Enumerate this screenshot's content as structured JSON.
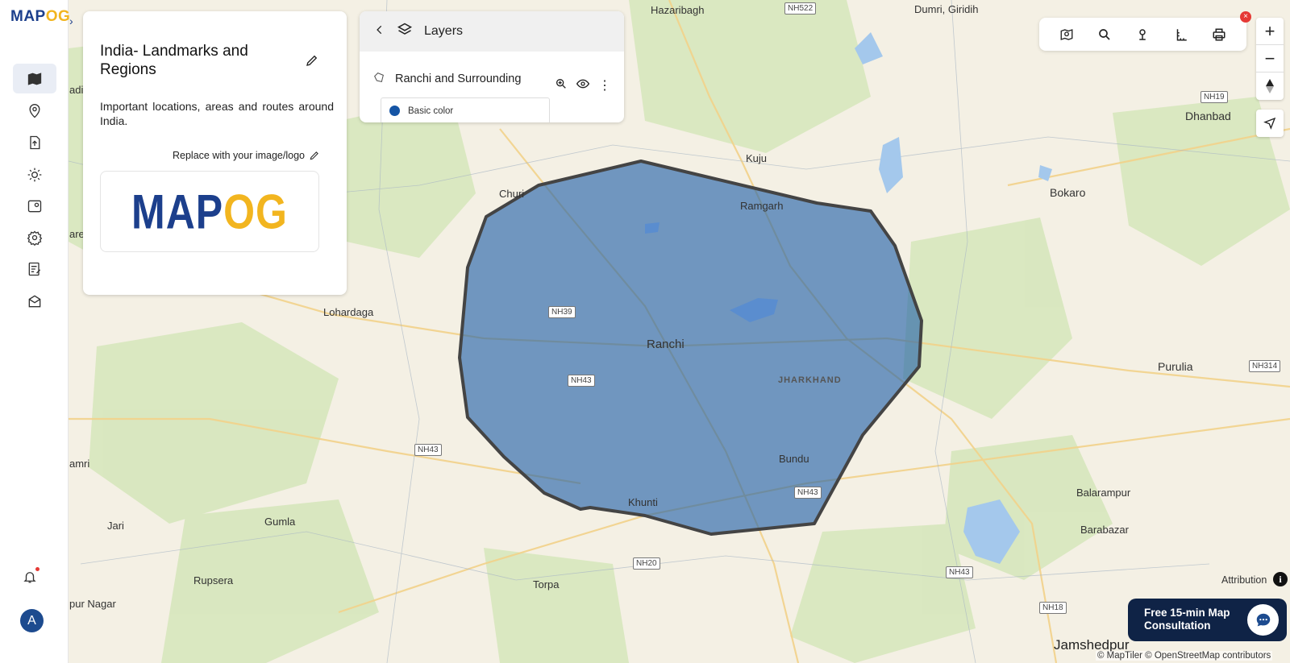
{
  "app": {
    "logo_main": "MAP",
    "logo_accent": "OG"
  },
  "info_card": {
    "title": "India- Landmarks and Regions",
    "description": "Important locations, areas and routes around India.",
    "replace_logo_label": "Replace with your image/logo",
    "logo_main": "MAP",
    "logo_accent": "OG"
  },
  "layers_panel": {
    "title": "Layers",
    "layer_name": "Ranchi and Surrounding",
    "style_label": "Basic color",
    "style_color": "#1555a5"
  },
  "user": {
    "avatar_initial": "A"
  },
  "zoom": {
    "in_label": "+",
    "out_label": "−"
  },
  "attribution": {
    "label": "Attribution",
    "info_glyph": "i",
    "copyright": "© MapTiler © OpenStreetMap contributors"
  },
  "consultation": {
    "line1": "Free 15-min Map",
    "line2": "Consultation"
  },
  "map": {
    "places": [
      {
        "name": "Hazaribagh",
        "cls": ""
      },
      {
        "name": "Dumri, Giridih",
        "cls": ""
      },
      {
        "name": "Dhanbad",
        "cls": ""
      },
      {
        "name": "Kuju",
        "cls": ""
      },
      {
        "name": "Bokaro",
        "cls": ""
      },
      {
        "name": "Churi",
        "cls": ""
      },
      {
        "name": "Ramgarh",
        "cls": ""
      },
      {
        "name": "Lohardaga",
        "cls": ""
      },
      {
        "name": "Ranchi",
        "cls": ""
      },
      {
        "name": "JHARKHAND",
        "cls": "state"
      },
      {
        "name": "Purulia",
        "cls": ""
      },
      {
        "name": "Bundu",
        "cls": ""
      },
      {
        "name": "Khunti",
        "cls": ""
      },
      {
        "name": "Gumla",
        "cls": ""
      },
      {
        "name": "Jari",
        "cls": ""
      },
      {
        "name": "Balarampur",
        "cls": ""
      },
      {
        "name": "Barabazar",
        "cls": ""
      },
      {
        "name": "Torpa",
        "cls": ""
      },
      {
        "name": "Rupsera",
        "cls": ""
      },
      {
        "name": "pur Nagar",
        "cls": ""
      },
      {
        "name": "Jamshedpur",
        "cls": "big"
      },
      {
        "name": "amri",
        "cls": ""
      },
      {
        "name": "ares",
        "cls": ""
      },
      {
        "name": "adi",
        "cls": ""
      }
    ],
    "shields": [
      "NH522",
      "NH19",
      "NH39",
      "NH43",
      "NH43",
      "NH43",
      "NH314",
      "NH20",
      "NH43",
      "NH18"
    ],
    "region_fill": "#1e5fa8",
    "region_stroke": "#444444"
  }
}
